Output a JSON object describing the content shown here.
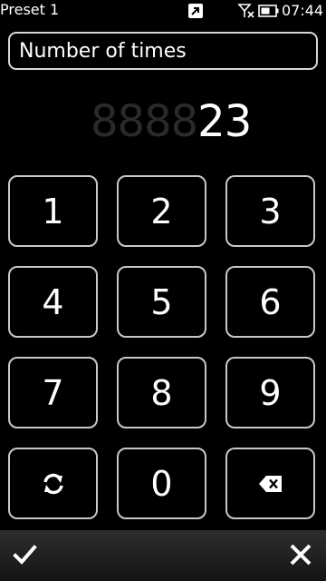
{
  "status_bar": {
    "title": "Preset 1",
    "time": "07:44",
    "icons": [
      "notification-icon",
      "no-signal-icon",
      "battery-icon"
    ]
  },
  "title_field": {
    "value": "Number of times"
  },
  "display": {
    "ghost": "8888",
    "value": "23"
  },
  "keypad": {
    "keys": [
      "1",
      "2",
      "3",
      "4",
      "5",
      "6",
      "7",
      "8",
      "9",
      "",
      "0",
      ""
    ],
    "reset_icon": "refresh-icon",
    "backspace_icon": "backspace-icon"
  },
  "toolbar": {
    "ok_icon": "checkmark-icon",
    "cancel_icon": "close-icon"
  }
}
